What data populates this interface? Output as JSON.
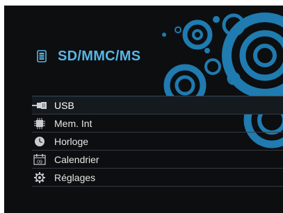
{
  "header": {
    "title": "SD/MMC/MS",
    "icon": "sd-card-icon"
  },
  "menu": {
    "items": [
      {
        "label": "USB",
        "icon": "usb-icon",
        "selected": true
      },
      {
        "label": "Mem. Int",
        "icon": "memory-chip-icon",
        "selected": false
      },
      {
        "label": "Horloge",
        "icon": "clock-icon",
        "selected": false
      },
      {
        "label": "Calendrier",
        "icon": "calendar-icon",
        "selected": false
      },
      {
        "label": "Réglages",
        "icon": "gear-icon",
        "selected": false
      }
    ]
  },
  "calendar_icon_day": "09",
  "colors": {
    "accent": "#58b6e6",
    "background": "#0d0e10",
    "separator": "#343b44"
  }
}
